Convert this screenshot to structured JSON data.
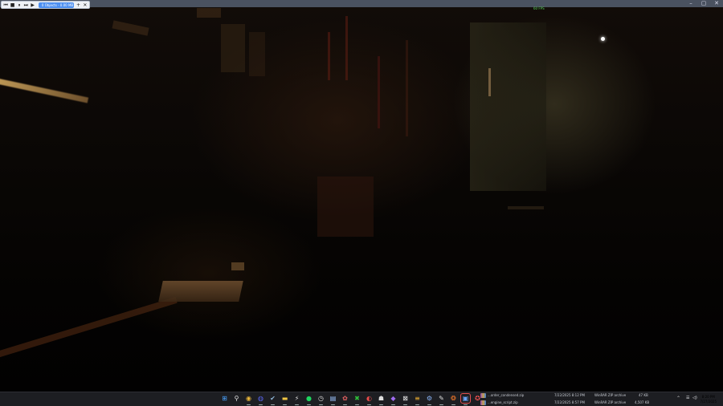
{
  "recorder": {
    "status": "0 Objects - 0.00 MB",
    "buttons": [
      "skip-back",
      "stop",
      "pause",
      "skip-forward",
      "play"
    ],
    "add_label": "+",
    "close_label": "✕"
  },
  "game": {
    "fps_readout": "60 FPS"
  },
  "window_controls": {
    "minimize": "–",
    "maximize": "▢",
    "close": "✕"
  },
  "taskbar": {
    "icons": [
      {
        "name": "start-icon",
        "glyph": "⊞",
        "color": "#4aa3ff"
      },
      {
        "name": "search-icon",
        "glyph": "⚲",
        "color": "#e0e0e0"
      },
      {
        "name": "chrome-icon",
        "glyph": "◉",
        "color": "#e8b53a"
      },
      {
        "name": "discord-icon",
        "glyph": "◍",
        "color": "#5865f2"
      },
      {
        "name": "steam-icon",
        "glyph": "✔",
        "color": "#8fb6d8"
      },
      {
        "name": "file-explorer-icon",
        "glyph": "▬",
        "color": "#f2c744"
      },
      {
        "name": "bolt-icon",
        "glyph": "⚡",
        "color": "#ddd"
      },
      {
        "name": "spotify-icon",
        "glyph": "●",
        "color": "#1ed760"
      },
      {
        "name": "clock-app-icon",
        "glyph": "◷",
        "color": "#ddd"
      },
      {
        "name": "notepad-icon",
        "glyph": "▤",
        "color": "#9cc4ff"
      },
      {
        "name": "palette-icon",
        "glyph": "✿",
        "color": "#e06060"
      },
      {
        "name": "xbox-icon",
        "glyph": "✖",
        "color": "#2fbf3a"
      },
      {
        "name": "record-icon",
        "glyph": "◐",
        "color": "#e84a4a"
      },
      {
        "name": "bot-icon",
        "glyph": "☗",
        "color": "#ddd"
      },
      {
        "name": "game-launcher-icon",
        "glyph": "◆",
        "color": "#a06cf0"
      },
      {
        "name": "capcut-icon",
        "glyph": "⊠",
        "color": "#eee"
      },
      {
        "name": "burger-icon",
        "glyph": "≡",
        "color": "#f0b030"
      },
      {
        "name": "settings-icon",
        "glyph": "⚙",
        "color": "#8ab4f8"
      },
      {
        "name": "gesture-icon",
        "glyph": "✎",
        "color": "#ddd"
      },
      {
        "name": "blender-icon",
        "glyph": "❂",
        "color": "#f5792a"
      },
      {
        "name": "screen-recorder-icon",
        "glyph": "▣",
        "color": "#6aa7ff"
      },
      {
        "name": "pinned-app-icon",
        "glyph": "✪",
        "color": "#f05050"
      }
    ],
    "files": [
      {
        "name": "...order_condensed.zip",
        "date": "7/22/2025 8:12 PM",
        "type": "WinRAR ZIP archive",
        "size": "47 KB"
      },
      {
        "name": "...engine_script.zip",
        "date": "7/22/2025 8:57 PM",
        "type": "WinRAR ZIP archive",
        "size": "4,507 KB"
      }
    ],
    "tray": {
      "chevron": "⌃",
      "wifi": "☰",
      "volume": "◁)",
      "time": "8:20 PM",
      "date": "7/27/2025"
    }
  },
  "colors": {
    "taskbar_bg": "#1d1e22",
    "recorder_accent": "#4c8ff1"
  }
}
